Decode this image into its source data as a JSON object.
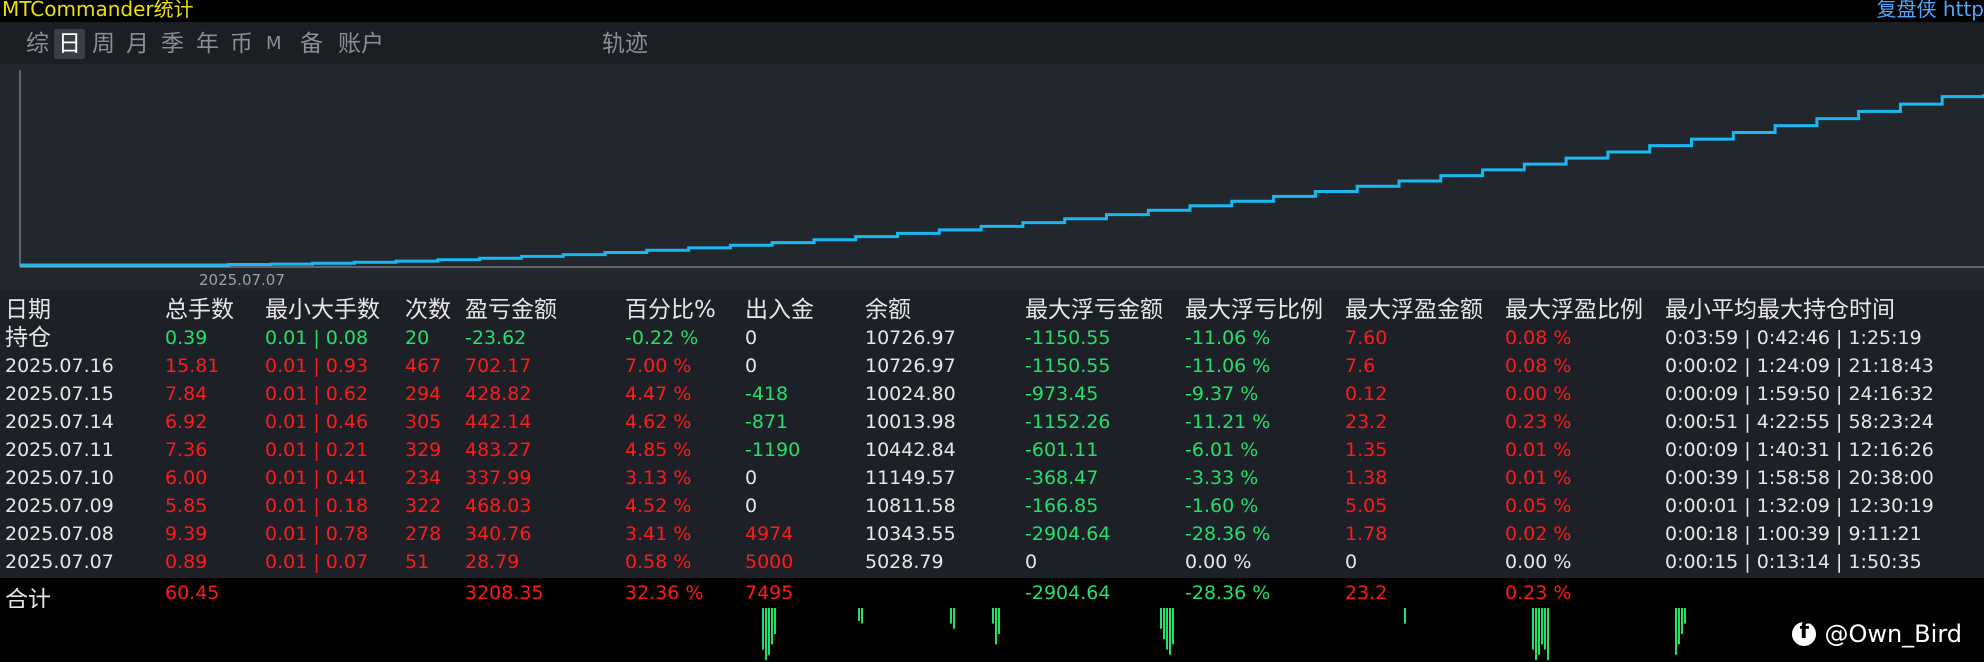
{
  "title": "MTCommander统计",
  "title_right": "复盘侠 http",
  "tabs": [
    {
      "label": "综",
      "active": false
    },
    {
      "label": "日",
      "active": true
    },
    {
      "label": "周",
      "active": false
    },
    {
      "label": "月",
      "active": false
    },
    {
      "label": "季",
      "active": false
    },
    {
      "label": "年",
      "active": false
    },
    {
      "label": "币",
      "active": false
    },
    {
      "label": "M",
      "active": false
    },
    {
      "label": "备",
      "active": false
    },
    {
      "label": "账户",
      "active": false
    },
    {
      "label": "轨迹",
      "active": false
    }
  ],
  "chart_data": {
    "type": "line",
    "x_label": "2025.07.07",
    "line_color": "#19b8f0",
    "values": [
      0,
      0,
      0,
      0,
      0,
      0.3,
      0.5,
      1,
      1.6,
      2.3,
      3.1,
      4,
      5,
      6.1,
      7.3,
      8.6,
      10,
      11.5,
      13.1,
      14.8,
      16.6,
      18.5,
      20.5,
      22.6,
      24.8,
      27.1,
      29.5,
      32,
      34.6,
      37.3,
      40.1,
      43,
      46,
      49.1,
      52.3,
      55.6,
      59,
      62.5,
      66.1,
      69.8,
      73.6,
      77.5,
      81.5,
      85.6,
      89.8,
      94.1,
      98.5,
      100
    ]
  },
  "table": {
    "headers": [
      "日期",
      "总手数",
      "最小大手数",
      "次数",
      "盈亏金额",
      "百分比%",
      "出入金",
      "余额",
      "最大浮亏金额",
      "最大浮亏比例",
      "最大浮盈金额",
      "最大浮盈比例",
      "最小平均最大持仓时间"
    ],
    "rows": [
      {
        "date": "持仓",
        "lots": "0.39",
        "minmax": "0.01 | 0.08",
        "count": "20",
        "pnl": "-23.62",
        "pct": "-0.22 %",
        "flow": "0",
        "balance": "10726.97",
        "maxloss": "-1150.55",
        "maxlosspct": "-11.06 %",
        "maxprofit": "7.60",
        "maxprofitpct": "0.08 %",
        "time": "0:03:59 | 0:42:46 | 1:25:19"
      },
      {
        "date": "2025.07.16",
        "lots": "15.81",
        "minmax": "0.01 | 0.93",
        "count": "467",
        "pnl": "702.17",
        "pct": "7.00 %",
        "flow": "0",
        "balance": "10726.97",
        "maxloss": "-1150.55",
        "maxlosspct": "-11.06 %",
        "maxprofit": "7.6",
        "maxprofitpct": "0.08 %",
        "time": "0:00:02 | 1:24:09 | 21:18:43"
      },
      {
        "date": "2025.07.15",
        "lots": "7.84",
        "minmax": "0.01 | 0.62",
        "count": "294",
        "pnl": "428.82",
        "pct": "4.47 %",
        "flow": "-418",
        "balance": "10024.80",
        "maxloss": "-973.45",
        "maxlosspct": "-9.37 %",
        "maxprofit": "0.12",
        "maxprofitpct": "0.00 %",
        "time": "0:00:09 | 1:59:50 | 24:16:32"
      },
      {
        "date": "2025.07.14",
        "lots": "6.92",
        "minmax": "0.01 | 0.46",
        "count": "305",
        "pnl": "442.14",
        "pct": "4.62 %",
        "flow": "-871",
        "balance": "10013.98",
        "maxloss": "-1152.26",
        "maxlosspct": "-11.21 %",
        "maxprofit": "23.2",
        "maxprofitpct": "0.23 %",
        "time": "0:00:51 | 4:22:55 | 58:23:24"
      },
      {
        "date": "2025.07.11",
        "lots": "7.36",
        "minmax": "0.01 | 0.21",
        "count": "329",
        "pnl": "483.27",
        "pct": "4.85 %",
        "flow": "-1190",
        "balance": "10442.84",
        "maxloss": "-601.11",
        "maxlosspct": "-6.01 %",
        "maxprofit": "1.35",
        "maxprofitpct": "0.01 %",
        "time": "0:00:09 | 1:40:31 | 12:16:26"
      },
      {
        "date": "2025.07.10",
        "lots": "6.00",
        "minmax": "0.01 | 0.41",
        "count": "234",
        "pnl": "337.99",
        "pct": "3.13 %",
        "flow": "0",
        "balance": "11149.57",
        "maxloss": "-368.47",
        "maxlosspct": "-3.33 %",
        "maxprofit": "1.38",
        "maxprofitpct": "0.01 %",
        "time": "0:00:39 | 1:58:58 | 20:38:00"
      },
      {
        "date": "2025.07.09",
        "lots": "5.85",
        "minmax": "0.01 | 0.18",
        "count": "322",
        "pnl": "468.03",
        "pct": "4.52 %",
        "flow": "0",
        "balance": "10811.58",
        "maxloss": "-166.85",
        "maxlosspct": "-1.60 %",
        "maxprofit": "5.05",
        "maxprofitpct": "0.05 %",
        "time": "0:00:01 | 1:32:09 | 12:30:19"
      },
      {
        "date": "2025.07.08",
        "lots": "9.39",
        "minmax": "0.01 | 0.78",
        "count": "278",
        "pnl": "340.76",
        "pct": "3.41 %",
        "flow": "4974",
        "balance": "10343.55",
        "maxloss": "-2904.64",
        "maxlosspct": "-28.36 %",
        "maxprofit": "1.78",
        "maxprofitpct": "0.02 %",
        "time": "0:00:18 | 1:00:39 | 9:11:21"
      },
      {
        "date": "2025.07.07",
        "lots": "0.89",
        "minmax": "0.01 | 0.07",
        "count": "51",
        "pnl": "28.79",
        "pct": "0.58 %",
        "flow": "5000",
        "balance": "5028.79",
        "maxloss": "0",
        "maxlosspct": "0.00 %",
        "maxprofit": "0",
        "maxprofitpct": "0.00 %",
        "time": "0:00:15 | 0:13:14 | 1:50:35"
      }
    ],
    "total": {
      "date": "合计",
      "lots": "60.45",
      "pnl": "3208.35",
      "pct": "32.36 %",
      "flow": "7495",
      "maxloss": "-2904.64",
      "maxlosspct": "-28.36 %",
      "maxprofit": "23.2",
      "maxprofitpct": "0.23 %"
    }
  },
  "colors": {
    "positive": "#ff1a1a",
    "negative": "#22e06a",
    "neutral": "#e6e6e6",
    "title": "#e8e000",
    "accent": "#19b8f0"
  },
  "bottom_bars": [
    [
      {
        "t": "up",
        "h": 0.8
      },
      {
        "t": "up",
        "h": 1
      },
      {
        "t": "up",
        "h": 0.9
      },
      {
        "t": "up",
        "h": 0.7
      },
      {
        "t": "up",
        "h": 0.5
      }
    ],
    [
      {
        "t": "up",
        "h": 0.25
      },
      {
        "t": "up",
        "h": 0.3
      }
    ],
    [
      {
        "t": "up",
        "h": 0.3
      },
      {
        "t": "up",
        "h": 0.4
      }
    ],
    [
      {
        "t": "up",
        "h": 0.3
      },
      {
        "t": "up",
        "h": 0.7
      },
      {
        "t": "up",
        "h": 0.5
      }
    ],
    [
      {
        "t": "up",
        "h": 0.4
      },
      {
        "t": "up",
        "h": 0.6
      },
      {
        "t": "up",
        "h": 0.8
      },
      {
        "t": "up",
        "h": 0.9
      },
      {
        "t": "up",
        "h": 0.7
      }
    ],
    [
      {
        "t": "up",
        "h": 0.3
      }
    ],
    [
      {
        "t": "up",
        "h": 0.8
      },
      {
        "t": "up",
        "h": 1
      },
      {
        "t": "up",
        "h": 0.9
      },
      {
        "t": "up",
        "h": 0.7
      },
      {
        "t": "up",
        "h": 0.8
      },
      {
        "t": "up",
        "h": 1
      }
    ],
    [
      {
        "t": "up",
        "h": 0.9
      },
      {
        "t": "up",
        "h": 0.7
      },
      {
        "t": "up",
        "h": 0.5
      },
      {
        "t": "up",
        "h": 0.3
      }
    ]
  ],
  "watermark": {
    "text": "@Own_Bird",
    "icon": "facebook-icon"
  }
}
